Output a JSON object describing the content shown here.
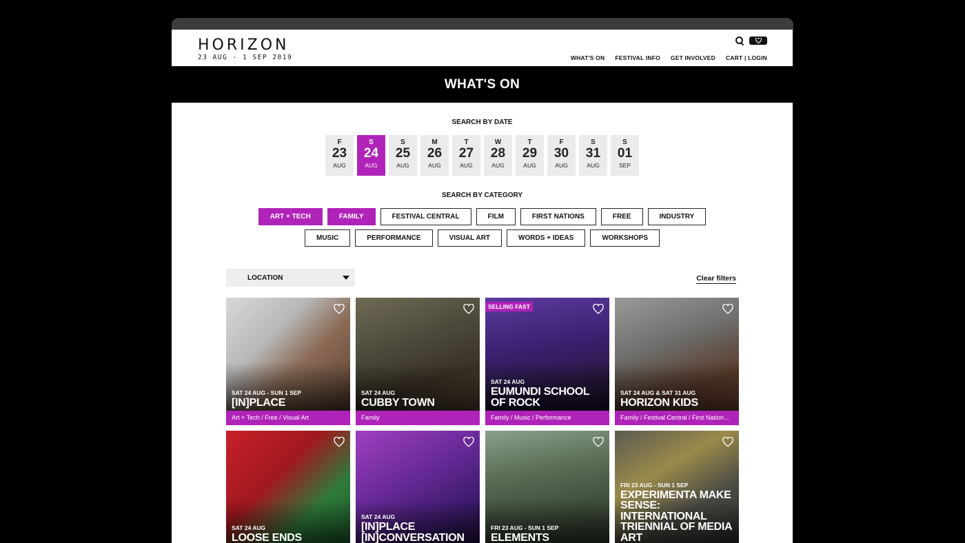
{
  "header": {
    "logo_text": "HORIZON",
    "logo_dates": "23 AUG - 1 SEP 2019",
    "fav_icon": "heart-icon",
    "nav": [
      "WHAT'S ON",
      "FESTIVAL INFO",
      "GET INVOLVED",
      "CART | LOGIN"
    ]
  },
  "banner": {
    "title": "WHAT'S ON"
  },
  "date_search": {
    "title": "SEARCH BY DATE",
    "dates": [
      {
        "day": "F",
        "num": "23",
        "month": "AUG",
        "active": false
      },
      {
        "day": "S",
        "num": "24",
        "month": "AUG",
        "active": true
      },
      {
        "day": "S",
        "num": "25",
        "month": "AUG",
        "active": false
      },
      {
        "day": "M",
        "num": "26",
        "month": "AUG",
        "active": false
      },
      {
        "day": "T",
        "num": "27",
        "month": "AUG",
        "active": false
      },
      {
        "day": "W",
        "num": "28",
        "month": "AUG",
        "active": false
      },
      {
        "day": "T",
        "num": "29",
        "month": "AUG",
        "active": false
      },
      {
        "day": "F",
        "num": "30",
        "month": "AUG",
        "active": false
      },
      {
        "day": "S",
        "num": "31",
        "month": "AUG",
        "active": false
      },
      {
        "day": "S",
        "num": "01",
        "month": "SEP",
        "active": false
      }
    ]
  },
  "category_search": {
    "title": "SEARCH BY CATEGORY",
    "categories": [
      {
        "label": "ART + TECH",
        "active": true
      },
      {
        "label": "FAMILY",
        "active": true
      },
      {
        "label": "FESTIVAL CENTRAL",
        "active": false
      },
      {
        "label": "FILM",
        "active": false
      },
      {
        "label": "FIRST NATIONS",
        "active": false
      },
      {
        "label": "FREE",
        "active": false
      },
      {
        "label": "INDUSTRY",
        "active": false
      },
      {
        "label": "MUSIC",
        "active": false
      },
      {
        "label": "PERFORMANCE",
        "active": false
      },
      {
        "label": "VISUAL ART",
        "active": false
      },
      {
        "label": "WORDS + IDEAS",
        "active": false
      },
      {
        "label": "WORKSHOPS",
        "active": false
      }
    ]
  },
  "filters": {
    "location_label": "LOCATION",
    "clear_label": "Clear filters"
  },
  "colors": {
    "accent": "#b023b8",
    "dark": "#000000",
    "date_bg": "#ebebeb"
  },
  "events": [
    {
      "date": "SAT 24 AUG - SUN 1 SEP",
      "title": "[IN]PLACE",
      "tags": "Art + Tech / Free / Visual Art",
      "badge": ""
    },
    {
      "date": "SAT 24 AUG",
      "title": "CUBBY TOWN",
      "tags": "Family",
      "badge": ""
    },
    {
      "date": "SAT 24 AUG",
      "title": "EUMUNDI SCHOOL OF ROCK",
      "tags": "Family / Music / Performance",
      "badge": "SELLING FAST"
    },
    {
      "date": "SAT 24 AUG & SAT 31 AUG",
      "title": "HORIZON KIDS",
      "tags": "Family / Festival Central / First Nation...",
      "badge": ""
    },
    {
      "date": "SAT 24 AUG",
      "title": "LOOSE ENDS",
      "tags": "",
      "badge": ""
    },
    {
      "date": "SAT 24 AUG",
      "title": "[IN]PLACE [IN]CONVERSATION",
      "tags": "",
      "badge": ""
    },
    {
      "date": "FRI 23 AUG - SUN 1 SEP",
      "title": "ELEMENTS",
      "tags": "",
      "badge": ""
    },
    {
      "date": "FRI 23 AUG - SUN 1 SEP",
      "title": "EXPERIMENTA MAKE SENSE: INTERNATIONAL TRIENNIAL OF MEDIA ART",
      "tags": "",
      "badge": ""
    }
  ]
}
